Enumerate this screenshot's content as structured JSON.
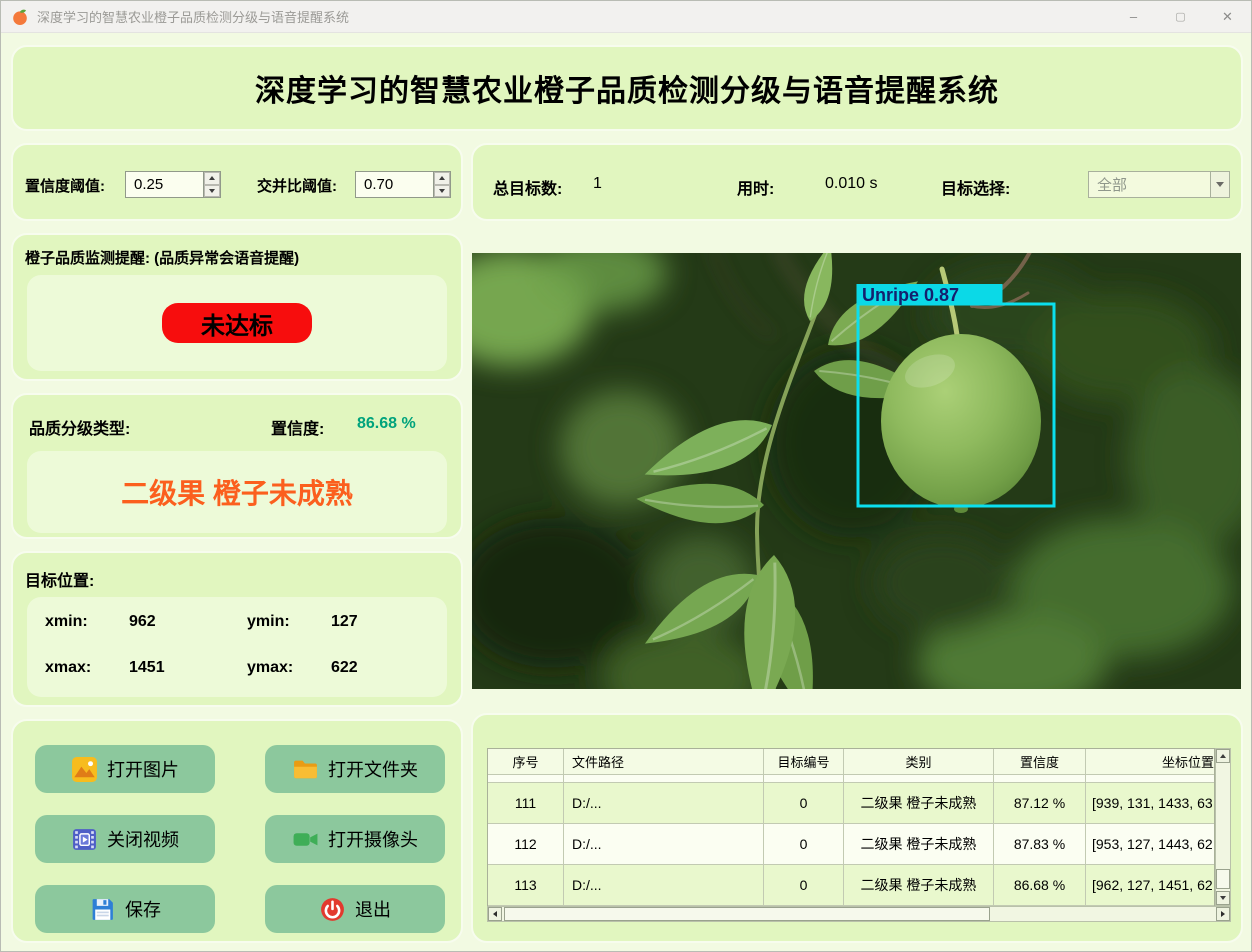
{
  "window": {
    "title": "深度学习的智慧农业橙子品质检测分级与语音提醒系统",
    "minimize": "–",
    "maximize": "▢",
    "close": "✕"
  },
  "header": {
    "title": "深度学习的智慧农业橙子品质检测分级与语音提醒系统"
  },
  "settings": {
    "conf_label": "置信度阈值:",
    "conf_value": "0.25",
    "iou_label": "交并比阈值:",
    "iou_value": "0.70"
  },
  "stats": {
    "total_label": "总目标数:",
    "total_value": "1",
    "time_label": "用时:",
    "time_value": "0.010 s",
    "select_label": "目标选择:",
    "select_value": "全部"
  },
  "reminder": {
    "title": "橙子品质监测提醒: (品质异常会语音提醒)",
    "status": "未达标"
  },
  "grading": {
    "type_label": "品质分级类型:",
    "conf_label": "置信度:",
    "conf_value": "86.68 %",
    "result": "二级果 橙子未成熟"
  },
  "position": {
    "title": "目标位置:",
    "xmin_label": "xmin:",
    "xmin": "962",
    "ymin_label": "ymin:",
    "ymin": "127",
    "xmax_label": "xmax:",
    "xmax": "1451",
    "ymax_label": "ymax:",
    "ymax": "622"
  },
  "buttons": [
    {
      "label": "打开图片",
      "icon": "image-icon"
    },
    {
      "label": "打开文件夹",
      "icon": "folder-icon"
    },
    {
      "label": "关闭视频",
      "icon": "video-icon"
    },
    {
      "label": "打开摄像头",
      "icon": "camera-icon"
    },
    {
      "label": "保存",
      "icon": "save-icon"
    },
    {
      "label": "退出",
      "icon": "power-icon"
    }
  ],
  "detection": {
    "label": "Unripe  0.87"
  },
  "table": {
    "headers": [
      "序号",
      "文件路径",
      "目标编号",
      "类别",
      "置信度",
      "坐标位置"
    ],
    "rows": [
      {
        "id": "111",
        "path": "D:/...",
        "target": "0",
        "class": "二级果 橙子未成熟",
        "conf": "87.12 %",
        "coords": "[939, 131, 1433, 63"
      },
      {
        "id": "112",
        "path": "D:/...",
        "target": "0",
        "class": "二级果 橙子未成熟",
        "conf": "87.83 %",
        "coords": "[953, 127, 1443, 62"
      },
      {
        "id": "113",
        "path": "D:/...",
        "target": "0",
        "class": "二级果 橙子未成熟",
        "conf": "86.68 %",
        "coords": "[962, 127, 1451, 62"
      }
    ]
  },
  "colors": {
    "status_red": "#f70d0d",
    "result_orange": "#fb5f1e",
    "confidence_teal": "#00a37c",
    "detection_cyan": "#0bdfee",
    "detection_label_bg": "#0bd9e7",
    "detection_label_text": "#14206e",
    "button_green": "#8cc89d",
    "panel_green": "#e1f6bf"
  }
}
